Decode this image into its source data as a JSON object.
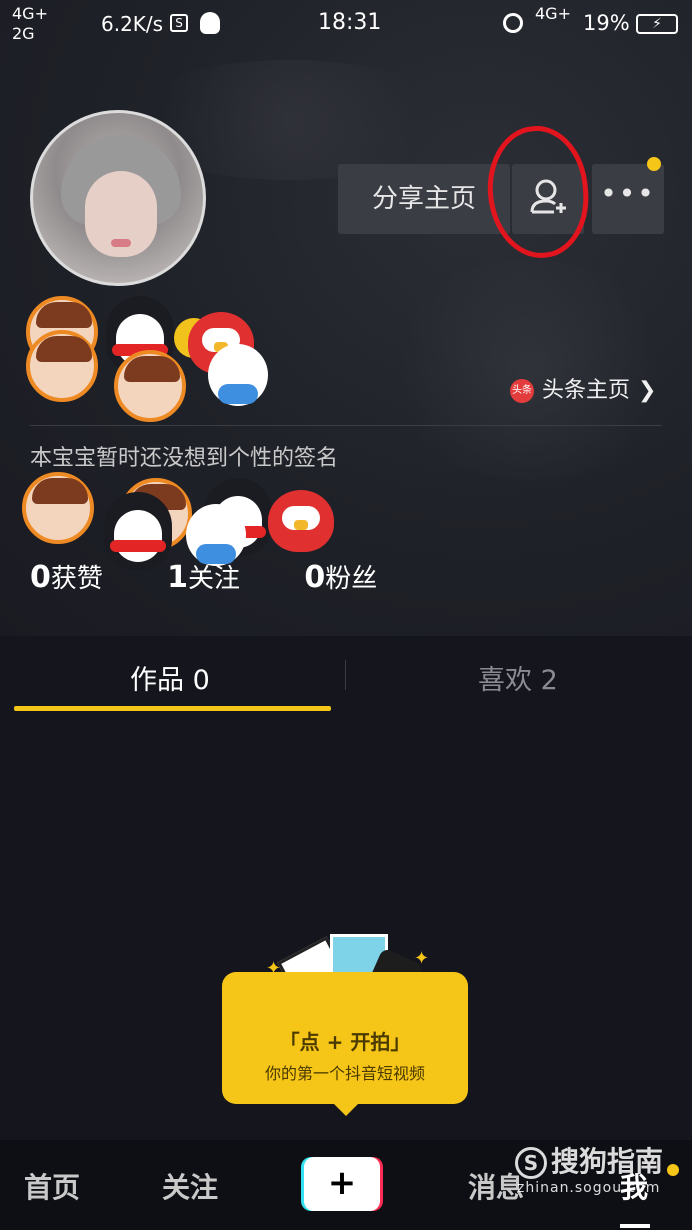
{
  "status_bar": {
    "net_left_top": "4G+",
    "net_left_bottom": "2G",
    "speed": "6.2K/s",
    "s_icon": "S",
    "time": "18:31",
    "net_right": "4G+",
    "battery_pct": "19%"
  },
  "profile": {
    "share_label": "分享主页",
    "more_label": "•••",
    "toutiao_icon": "头条",
    "toutiao_label": "头条主页",
    "signature": "本宝宝暂时还没想到个性的签名",
    "stats": {
      "likes_count": "0",
      "likes_label": "获赞",
      "following_count": "1",
      "following_label": "关注",
      "followers_count": "0",
      "followers_label": "粉丝"
    }
  },
  "tabs": {
    "works": "作品 0",
    "likes": "喜欢 2"
  },
  "prompt": {
    "title": "「点 + 开拍」",
    "subtitle": "你的第一个抖音短视频"
  },
  "bottom_nav": {
    "home": "首页",
    "follow": "关注",
    "plus": "+",
    "messages": "消息",
    "me": "我"
  },
  "watermark": {
    "brand": "搜狗指南",
    "url": "zhinan.sogou.com"
  },
  "colors": {
    "accent": "#f5c518",
    "annotation": "#e2141d",
    "background": "#14151d"
  }
}
